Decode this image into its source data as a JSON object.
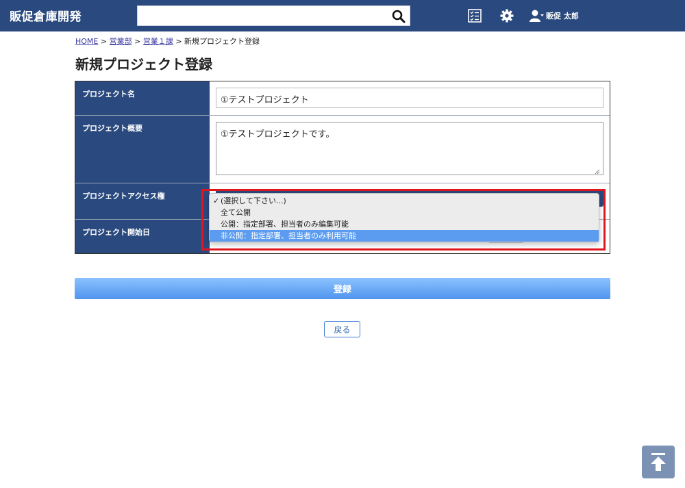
{
  "header": {
    "app_title": "販促倉庫開発",
    "search": {
      "value": "",
      "placeholder": ""
    },
    "user_name": "販促 太郎"
  },
  "breadcrumb": {
    "items": [
      "HOME",
      "営業部",
      "営業１課"
    ],
    "separator": ">",
    "current": "新規プロジェクト登録"
  },
  "page_title": "新規プロジェクト登録",
  "form": {
    "project_name": {
      "label": "プロジェクト名",
      "value": "①テストプロジェクト"
    },
    "project_summary": {
      "label": "プロジェクト概要",
      "value": "①テストプロジェクトです。"
    },
    "access": {
      "label": "プロジェクトアクセス権",
      "options": [
        "(選択して下さい...)",
        "全て公開",
        "公開：指定部署、担当者のみ編集可能",
        "非公開：指定部署、担当者のみ利用可能"
      ],
      "checked_index": 0,
      "highlighted_index": 3
    },
    "start_date": {
      "label": "プロジェクト開始日"
    }
  },
  "buttons": {
    "register": "登録",
    "back": "戻る"
  },
  "colors": {
    "header_bg": "#2a4a7f",
    "highlight": "#e0161f",
    "option_selected": "#5b9cf0"
  }
}
